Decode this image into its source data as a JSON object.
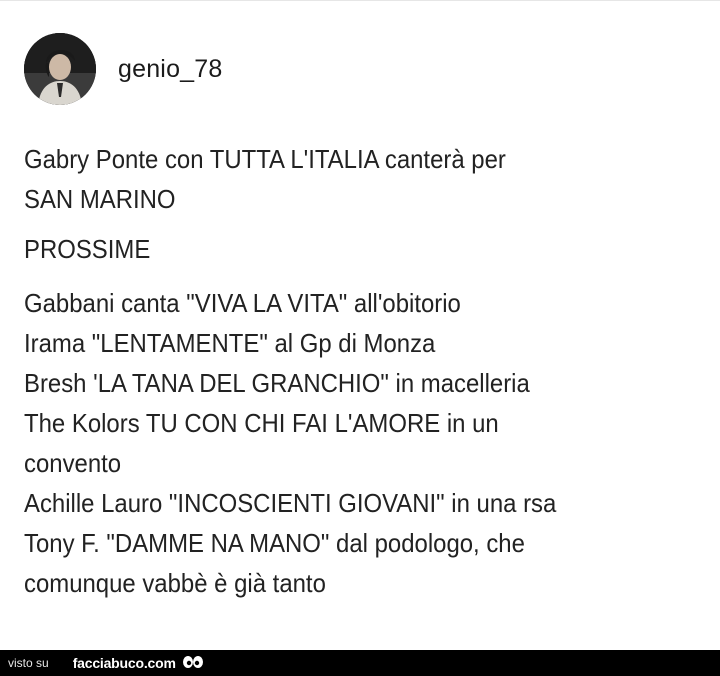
{
  "post": {
    "username": "genio_78",
    "avatar_icon": "user-avatar-photo",
    "title_lines": [
      "Gabry Ponte con TUTTA L'ITALIA canterà per",
      "SAN MARINO"
    ],
    "section_heading": "PROSSIME",
    "items": [
      "Gabbani canta \"VIVA LA VITA\" all'obitorio",
      "Irama \"LENTAMENTE\" al Gp di Monza",
      "Bresh 'LA TANA DEL GRANCHIO\" in  macelleria",
      "The Kolors TU CON CHI FAI L'AMORE in un",
      "convento",
      "Achille Lauro \"INCOSCIENTI GIOVANI\" in una rsa",
      "Tony F. \"DAMME NA MANO\" dal podologo, che",
      "comunque vabbè è già tanto"
    ]
  },
  "footer": {
    "visto_label": "visto su",
    "brand": "facciabuco.com",
    "logo_icon": "eyes-logo-icon"
  },
  "colors": {
    "text": "#222222",
    "background": "#ffffff",
    "footer_background": "#000000"
  }
}
